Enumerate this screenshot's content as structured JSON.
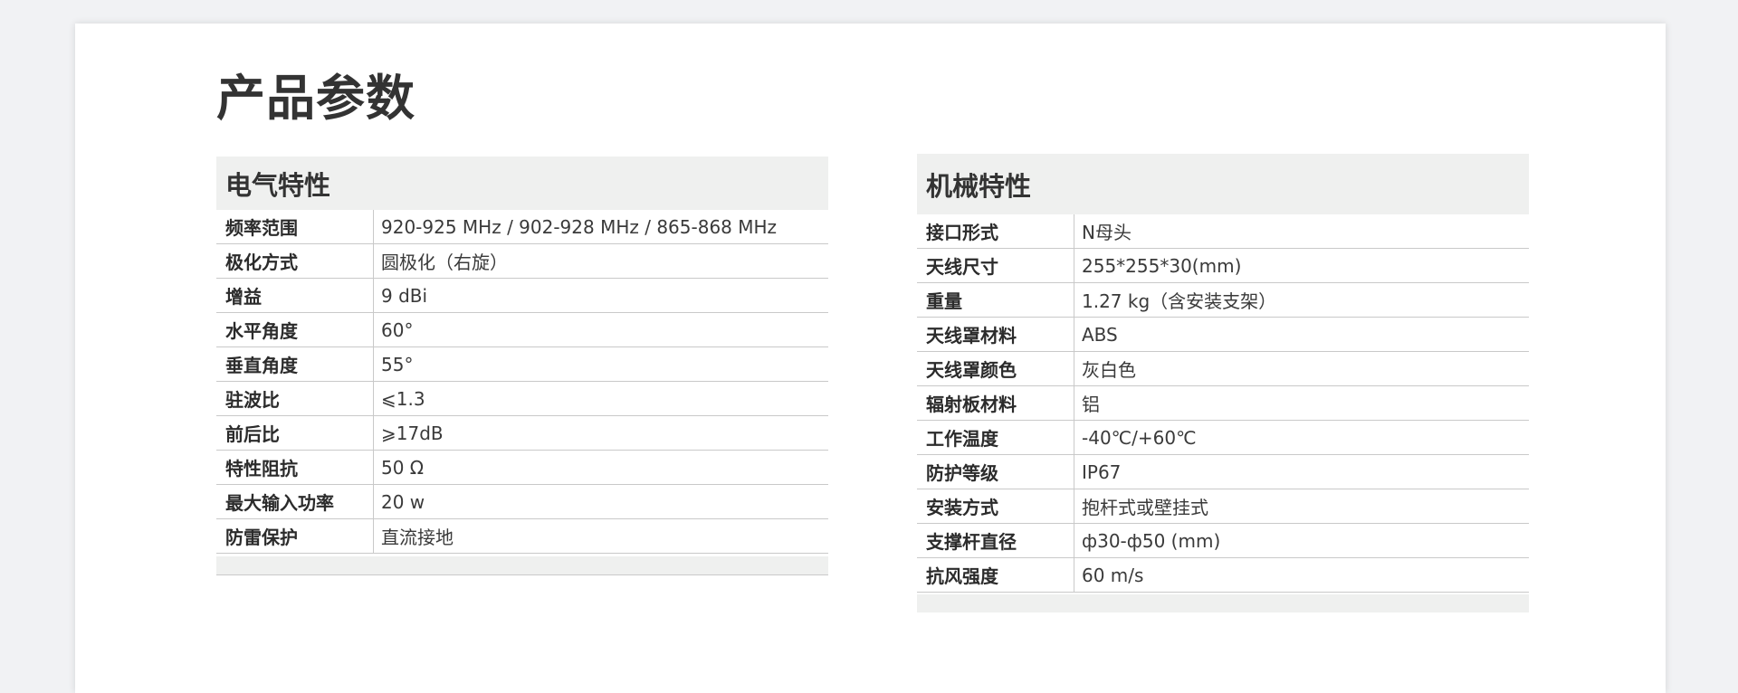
{
  "page": {
    "title": "产品参数"
  },
  "electrical": {
    "title": "电气特性",
    "rows": [
      {
        "key": "频率范围",
        "value": "920-925 MHz / 902-928 MHz / 865-868 MHz"
      },
      {
        "key": "极化方式",
        "value": "圆极化（右旋）"
      },
      {
        "key": "增益",
        "value": "9 dBi"
      },
      {
        "key": "水平角度",
        "value": "60°"
      },
      {
        "key": "垂直角度",
        "value": "55°"
      },
      {
        "key": "驻波比",
        "value": "⩽1.3"
      },
      {
        "key": "前后比",
        "value": "⩾17dB"
      },
      {
        "key": "特性阻抗",
        "value": "50 Ω"
      },
      {
        "key": "最大输入功率",
        "value": "20 w"
      },
      {
        "key": "防雷保护",
        "value": "直流接地"
      }
    ]
  },
  "mechanical": {
    "title": "机械特性",
    "rows": [
      {
        "key": "接口形式",
        "value": "N母头"
      },
      {
        "key": "天线尺寸",
        "value": "255*255*30(mm)"
      },
      {
        "key": "重量",
        "value": "1.27 kg（含安装支架）"
      },
      {
        "key": "天线罩材料",
        "value": "ABS"
      },
      {
        "key": "天线罩颜色",
        "value": "灰白色"
      },
      {
        "key": "辐射板材料",
        "value": "铝"
      },
      {
        "key": "工作温度",
        "value": "-40℃/+60℃"
      },
      {
        "key": "防护等级",
        "value": "IP67"
      },
      {
        "key": "安装方式",
        "value": "抱杆式或壁挂式"
      },
      {
        "key": "支撑杆直径",
        "value": "ф30-ф50 (mm)"
      },
      {
        "key": "抗风强度",
        "value": "60 m/s"
      }
    ]
  }
}
